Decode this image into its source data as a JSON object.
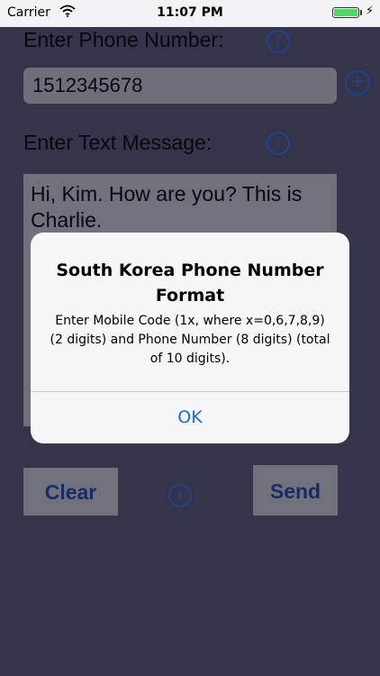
{
  "status_bar": {
    "carrier": "Carrier",
    "wifi_icon": "wifi-icon",
    "time": "11:07 PM",
    "battery_icon": "battery-icon",
    "battery_level": 1.0,
    "charging_icon": "charging-bolt-icon"
  },
  "phone": {
    "label": "Enter Phone Number:",
    "value": "1512345678",
    "info_icon": "i",
    "add_icon": "+"
  },
  "message": {
    "label": "Enter Text Message:",
    "value": "Hi, Kim.  How are you?  This is Charlie.",
    "info_icon": "i"
  },
  "buttons": {
    "clear_label": "Clear",
    "send_label": "Send",
    "info_icon": "i"
  },
  "alert": {
    "title": "South Korea Phone Number Format",
    "message": "Enter Mobile Code (1x, where x=0,6,7,8,9) (2 digits) and Phone Number (8 digits) (total of 10 digits).",
    "ok_label": "OK"
  },
  "colors": {
    "background": "#45455f",
    "accent": "#2a5bc7",
    "button_text": "#1a3a8c",
    "field_bg": "#a3a3a8",
    "battery": "#4cd964"
  }
}
